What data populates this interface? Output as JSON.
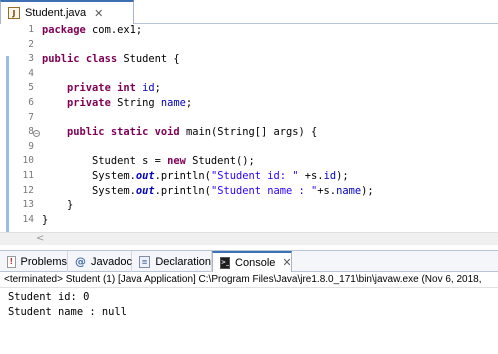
{
  "editor": {
    "tab": {
      "icon": "java-file-icon",
      "label": "Student.java",
      "close_glyph": "✕"
    },
    "line_numbers": [
      "1",
      "2",
      "3",
      "4",
      "5",
      "6",
      "7",
      "8",
      "9",
      "10",
      "11",
      "12",
      "13",
      "14"
    ],
    "code": [
      "package com.ex1;",
      "",
      "public class Student {",
      "",
      "    private int id;",
      "    private String name;",
      "",
      "    public static void main(String[] args) {",
      "",
      "        Student s = new Student();",
      "        System.out.println(\"Student id: \" +s.id);",
      "        System.out.println(\"Student name : \"+s.name);",
      "    }",
      "}"
    ],
    "fold_glyph": "−",
    "scroll_left_glyph": "<"
  },
  "views": {
    "tabs": [
      {
        "icon": "problems-icon",
        "label": "Problems"
      },
      {
        "icon": "javadoc-icon",
        "label": "Javadoc"
      },
      {
        "icon": "declaration-icon",
        "label": "Declaration"
      },
      {
        "icon": "console-icon",
        "label": "Console",
        "active": true,
        "close_glyph": "✕"
      }
    ]
  },
  "console": {
    "header": "<terminated> Student (1) [Java Application] C:\\Program Files\\Java\\jre1.8.0_171\\bin\\javaw.exe (Nov 6, 2018,",
    "output": [
      "Student id: 0",
      "Student name : null"
    ]
  },
  "colors": {
    "keyword": "#7f0055",
    "field": "#0000c0",
    "string": "#2a00ff",
    "active_tab_border": "#3c6fb4",
    "gutter_highlight": "#9bbcdf"
  }
}
